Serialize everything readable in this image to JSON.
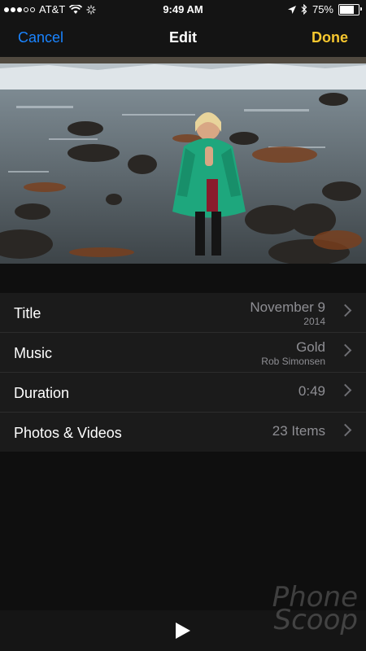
{
  "status_bar": {
    "carrier": "AT&T",
    "time": "9:49 AM",
    "battery": "75%",
    "battery_level": 0.75
  },
  "nav": {
    "cancel": "Cancel",
    "title": "Edit",
    "done": "Done"
  },
  "rows": [
    {
      "label": "Title",
      "value": "November 9",
      "sub": "2014"
    },
    {
      "label": "Music",
      "value": "Gold",
      "sub": "Rob Simonsen"
    },
    {
      "label": "Duration",
      "value": "0:49"
    },
    {
      "label": "Photos & Videos",
      "value": "23 Items"
    }
  ],
  "watermark": {
    "line1": "Phone",
    "line2": "Scoop"
  },
  "colors": {
    "cancel": "#1a84ff",
    "done": "#f7c72f",
    "background": "#0f0f0f",
    "list_background": "#1b1b1b"
  }
}
